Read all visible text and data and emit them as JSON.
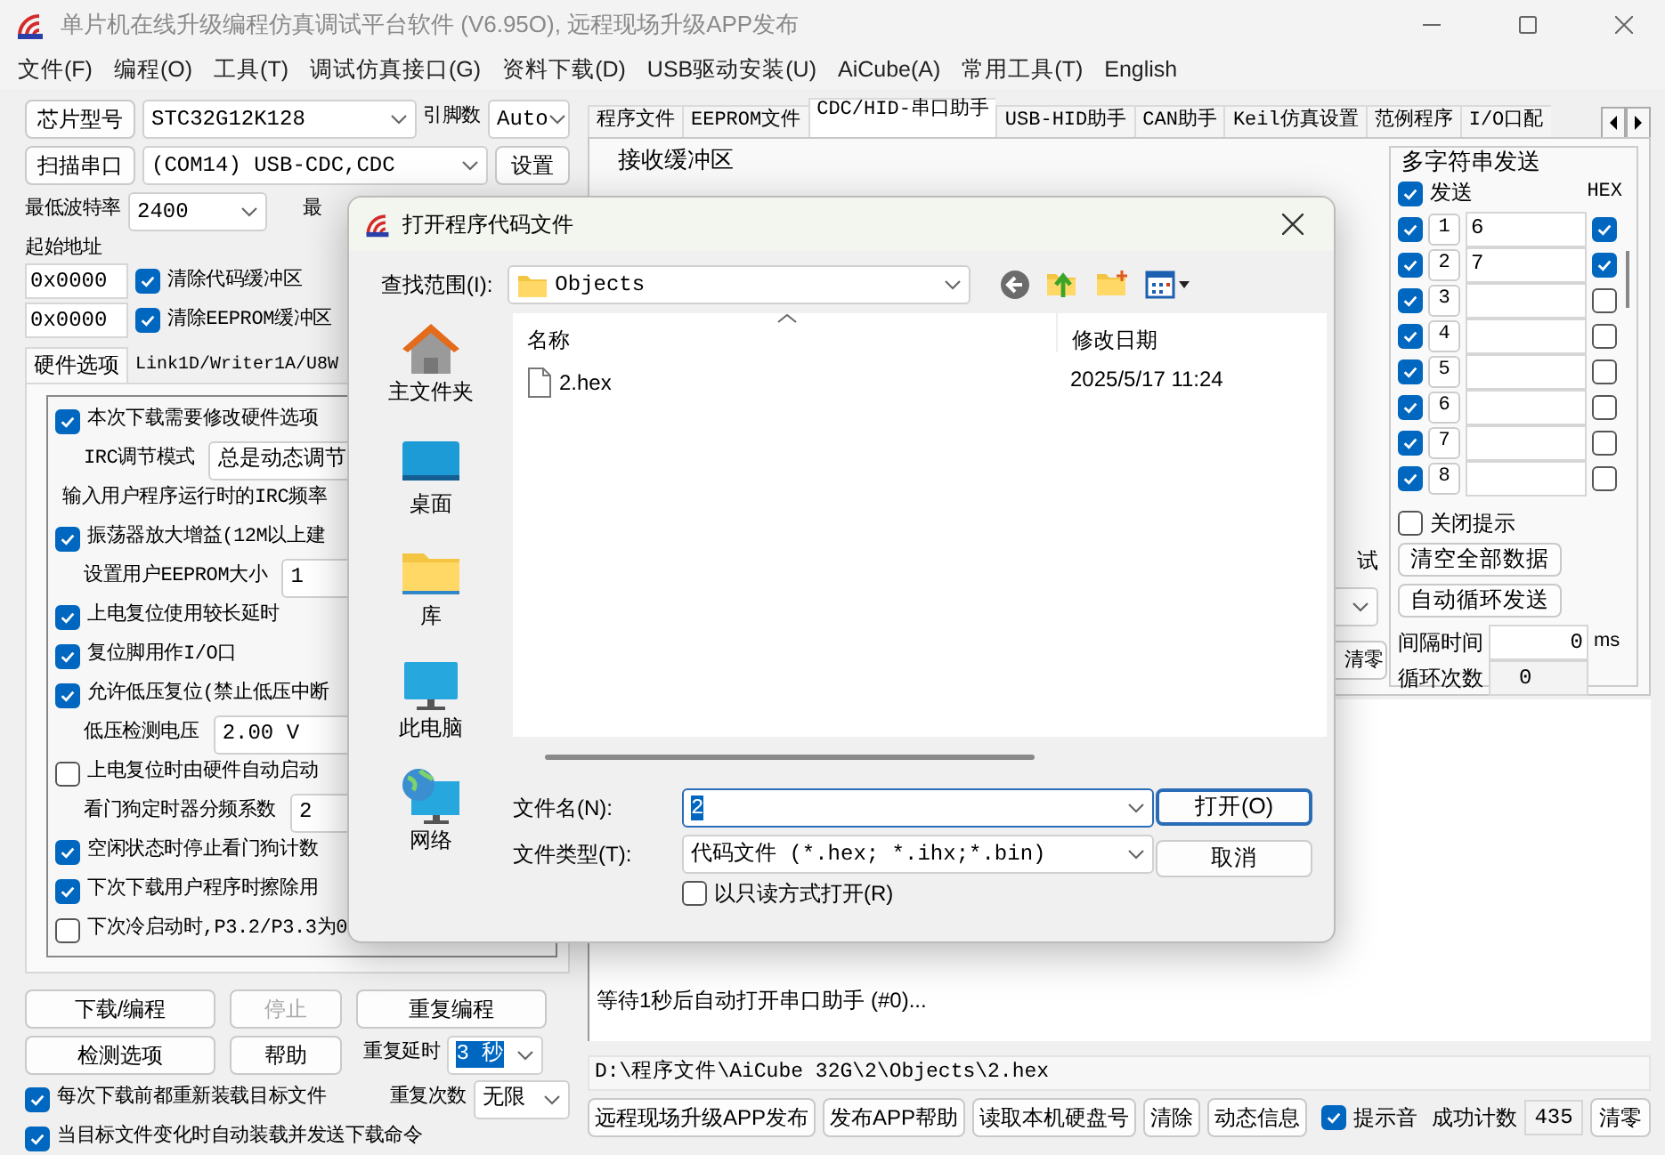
{
  "window": {
    "title": "单片机在线升级编程仿真调试平台软件 (V6.95O), 远程现场升级APP发布"
  },
  "menu": [
    "文件(F)",
    "编程(O)",
    "工具(T)",
    "调试仿真接口(G)",
    "资料下载(D)",
    "USB驱动安装(U)",
    "AiCube(A)",
    "常用工具(T)",
    "English"
  ],
  "chip": {
    "button": "芯片型号",
    "value": "STC32G12K128",
    "pins_label": "引脚数",
    "pins_value": "Auto"
  },
  "port": {
    "button": "扫描串口",
    "value": "(COM14) USB-CDC,CDC",
    "settings_button": "设置"
  },
  "baud": {
    "label": "最低波特率",
    "value": "2400",
    "label_2": "最"
  },
  "start_address": {
    "label": "起始地址",
    "rows": [
      {
        "value": "0x0000",
        "option": "清除代码缓冲区",
        "checked": true
      },
      {
        "value": "0x0000",
        "option": "清除EEPROM缓冲区",
        "checked": true
      }
    ]
  },
  "left_tabs": [
    {
      "label": "硬件选项",
      "selected": true
    },
    {
      "label": "Link1D/Writer1A/U8W",
      "selected": false
    }
  ],
  "hardware_options": [
    {
      "kind": "check",
      "label": "本次下载需要修改硬件选项",
      "checked": true
    },
    {
      "kind": "select",
      "label": "IRC调节模式",
      "value": "总是动态调节"
    },
    {
      "kind": "text",
      "label": "输入用户程序运行时的IRC频率"
    },
    {
      "kind": "check",
      "label": "振荡器放大增益(12M以上建",
      "checked": true
    },
    {
      "kind": "select",
      "label": "设置用户EEPROM大小",
      "value": "1"
    },
    {
      "kind": "check",
      "label": "上电复位使用较长延时",
      "checked": true
    },
    {
      "kind": "check",
      "label": "复位脚用作I/O口",
      "checked": true
    },
    {
      "kind": "check",
      "label": "允许低压复位(禁止低压中断",
      "checked": true
    },
    {
      "kind": "select",
      "label": "低压检测电压",
      "value": "2.00 V"
    },
    {
      "kind": "check",
      "label": "上电复位时由硬件自动启动",
      "checked": false
    },
    {
      "kind": "select",
      "label": "看门狗定时器分频系数",
      "value": "2"
    },
    {
      "kind": "check",
      "label": "空闲状态时停止看门狗计数",
      "checked": true
    },
    {
      "kind": "check",
      "label": "下次下载用户程序时擦除用",
      "checked": true
    },
    {
      "kind": "check",
      "label": "下次冷启动时,P3.2/P3.3为0",
      "checked": false
    }
  ],
  "action_buttons": [
    {
      "label": "下载/编程",
      "disabled": false
    },
    {
      "label": "停止",
      "disabled": true
    },
    {
      "label": "重复编程",
      "disabled": false
    },
    {
      "label": "检测选项",
      "disabled": false
    },
    {
      "label": "帮助",
      "disabled": false
    }
  ],
  "repeat_delay": {
    "label": "重复延时",
    "value": "3 秒",
    "highlighted": true
  },
  "repeat_count": {
    "label": "重复次数",
    "value": "无限",
    "highlighted": false
  },
  "reload_options": [
    {
      "label": "每次下载前都重新装载目标文件",
      "checked": true
    },
    {
      "label": "当目标文件变化时自动装载并发送下载命令",
      "checked": true
    }
  ],
  "main_tabs": [
    {
      "label": "程序文件",
      "selected": false
    },
    {
      "label": "EEPROM文件",
      "selected": false
    },
    {
      "label": "CDC/HID-串口助手",
      "selected": true
    },
    {
      "label": "USB-HID助手",
      "selected": false
    },
    {
      "label": "CAN助手",
      "selected": false
    },
    {
      "label": "Keil仿真设置",
      "selected": false
    },
    {
      "label": "范例程序",
      "selected": false
    },
    {
      "label": "I/O口配",
      "selected": false
    }
  ],
  "receive": {
    "title": "接收缓冲区",
    "label_2": "试",
    "clear_button": "清零"
  },
  "multi_send": {
    "title": "多字符串发送",
    "send_all": {
      "label": "发送",
      "checked": true
    },
    "hex_label": "HEX",
    "rows": [
      {
        "index": "1",
        "value": "6",
        "checked": true,
        "hex": true
      },
      {
        "index": "2",
        "value": "7",
        "checked": true,
        "hex": true
      },
      {
        "index": "3",
        "checked": true,
        "hex": false
      },
      {
        "index": "4",
        "checked": true,
        "hex": false
      },
      {
        "index": "5",
        "checked": true,
        "hex": false
      },
      {
        "index": "6",
        "checked": true,
        "hex": false
      },
      {
        "index": "7",
        "checked": true,
        "hex": false
      },
      {
        "index": "8",
        "checked": true,
        "hex": false
      }
    ],
    "close_hint": {
      "label": "关闭提示",
      "checked": false
    },
    "clear_button": "清空全部数据",
    "loop_button": "自动循环发送",
    "interval_label": "间隔时间",
    "interval": "0",
    "interval_unit": "ms",
    "loop_count_label": "循环次数",
    "loop_count": "0"
  },
  "log": [
    "等待1秒后自动打开串口助手 (#0)..."
  ],
  "file_path": "D:\\程序文件\\AiCube  32G\\2\\Objects\\2.hex",
  "bottom_buttons": [
    "远程现场升级APP发布",
    "发布APP帮助",
    "读取本机硬盘号",
    "清除",
    "动态信息"
  ],
  "sound": {
    "label": "提示音",
    "checked": true
  },
  "success_count": {
    "label": "成功计数",
    "value": "435",
    "reset_button": "清零"
  },
  "dialog": {
    "title": "打开程序代码文件",
    "look_in_label": "查找范围(I):",
    "look_in": "Objects",
    "places": [
      {
        "kind": "home",
        "label": "主文件夹"
      },
      {
        "kind": "desktop",
        "label": "桌面"
      },
      {
        "kind": "library",
        "label": "库"
      },
      {
        "kind": "computer",
        "label": "此电脑"
      },
      {
        "kind": "network",
        "label": "网络"
      }
    ],
    "columns": [
      "名称",
      "修改日期"
    ],
    "files": [
      {
        "name": "2.hex",
        "modified": "2025/5/17 11:24"
      }
    ],
    "filename_label": "文件名(N):",
    "filename": "2",
    "filename_highlighted": true,
    "filetype_label": "文件类型(T):",
    "filetype": "代码文件 (*.hex;  *.ihx;*.bin)",
    "readonly": {
      "label": "以只读方式打开(R)",
      "checked": false
    },
    "open_button": "打开(O)",
    "cancel_button": "取消"
  }
}
